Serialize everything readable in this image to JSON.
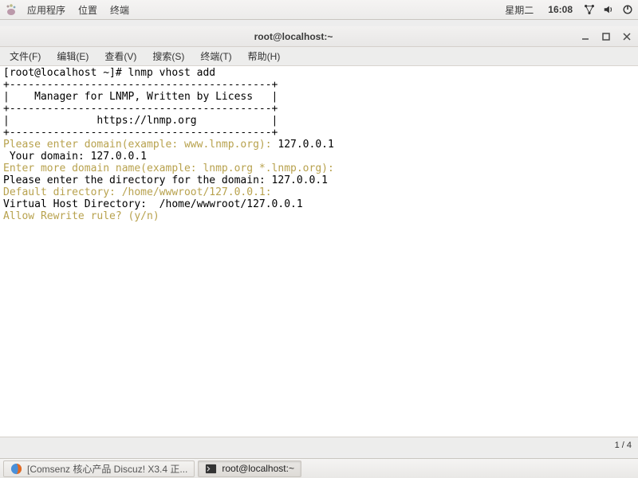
{
  "topbar": {
    "apps": "应用程序",
    "places": "位置",
    "terminal": "终端",
    "day": "星期二",
    "time": "16:08"
  },
  "window": {
    "title": "root@localhost:~"
  },
  "menu": {
    "file": "文件(F)",
    "edit": "编辑(E)",
    "view": "查看(V)",
    "search": "搜索(S)",
    "terminal": "终端(T)",
    "help": "帮助(H)"
  },
  "terminal": {
    "prompt_line": "[root@localhost ~]# lnmp vhost add",
    "border1": "+------------------------------------------+",
    "banner1": "|    Manager for LNMP, Written by Licess   |",
    "border2": "+------------------------------------------+",
    "banner2": "|              https://lnmp.org            |",
    "border3": "+------------------------------------------+",
    "p1_label": "Please enter domain(example: www.lnmp.org): ",
    "p1_val": "127.0.0.1",
    "p2": " Your domain: 127.0.0.1",
    "p3": "Enter more domain name(example: lnmp.org *.lnmp.org): ",
    "p4_label": "Please enter the directory for the domain: ",
    "p4_val": "127.0.0.1",
    "p5_a": "Default directory: /home/wwwroot/",
    "p5_b": "127.0.0.1",
    "p5_c": ":",
    "p6": "Virtual Host Directory:  /home/wwwroot/127.0.0.1",
    "p7": "Allow Rewrite rule? (y/n) ",
    "status": "1 / 4"
  },
  "taskbar": {
    "firefox_label": "[Comsenz 核心产品 Discuz! X3.4 正...",
    "term_label": "root@localhost:~"
  }
}
